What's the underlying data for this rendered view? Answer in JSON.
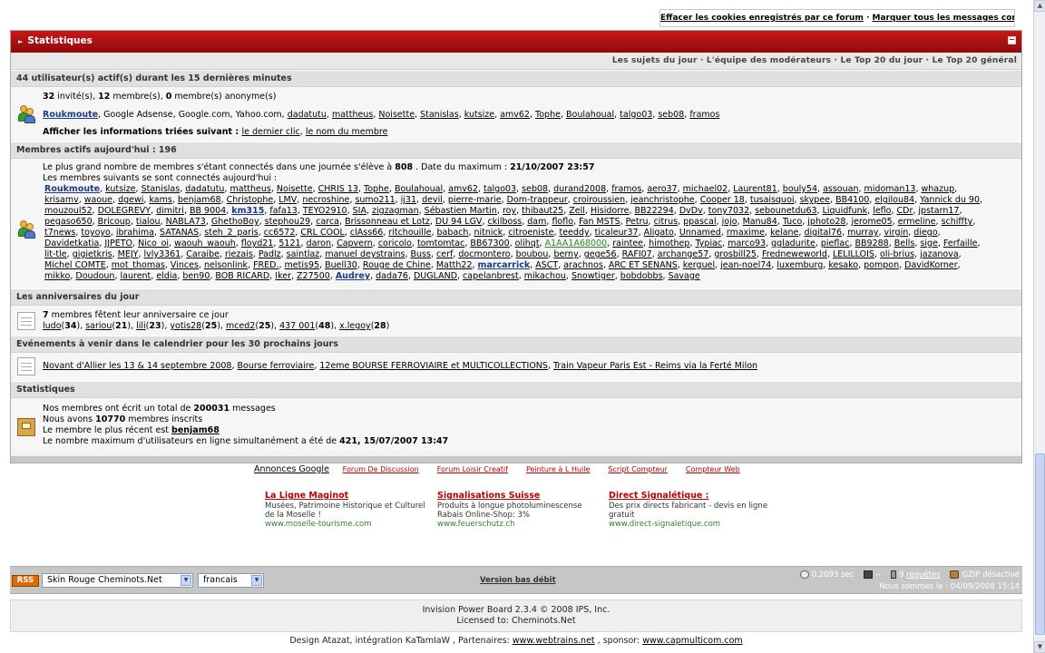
{
  "toplinks": {
    "clear_cookies": "Effacer les cookies enregistrés par ce forum",
    "separator": " · ",
    "mark_read": "Marquer tous les messages comme lus"
  },
  "panel": {
    "title": "Statistiques",
    "collapse_label": "−",
    "subnav": "Les sujets du jour · L'équipe des modérateurs · Le Top 20 du jour · Le Top 20 général"
  },
  "active_users": {
    "heading": "44 utilisateur(s) actif(s) durant les 15 dernières minutes",
    "guests_count": "32",
    "guests_label": " invité(s), ",
    "members_count": "12",
    "members_label": " membre(s), ",
    "anon_count": "0",
    "anon_label": " membre(s) anonyme(s)",
    "members": [
      "Roukmoute",
      "Google Adsense",
      "Google.com",
      "Yahoo.com",
      "dadatutu",
      "mattheus",
      "Noisette",
      "Stanislas",
      "kutsize",
      "amv62",
      "Tophe",
      "Boulahoual",
      "talgo03",
      "seb08",
      "framos"
    ],
    "sort_label": "Afficher les informations triées suivant : ",
    "sort_last_click": "le dernier clic",
    "sort_sep": ", ",
    "sort_name": "le nom du membre"
  },
  "active_today": {
    "heading": "Membres actifs aujourd'hui : 196",
    "record_prefix": "Le plus grand nombre de membres s'étant connectés dans une journée s'élève à ",
    "record_value": "808",
    "record_mid": " . Date du maximum : ",
    "record_date": "21/10/2007 23:57",
    "list_intro": "Les membres suivants se sont connectés aujourd'hui :",
    "members": [
      "Roukmoute",
      "kutsize",
      "Stanislas",
      "dadatutu",
      "mattheus",
      "Noisette",
      "CHRIS 13",
      "Tophe",
      "Boulahoual",
      "amv62",
      "talgo03",
      "seb08",
      "durand2008",
      "framos",
      "aero37",
      "michael02",
      "Laurent81",
      "bouly54",
      "assouan",
      "midoman13",
      "whazup",
      "krisamv",
      "waoue",
      "dgewi",
      "kams",
      "benjam68",
      "Christophe",
      "LMV",
      "necroshine",
      "sumo211",
      "ij31",
      "devil",
      "pierre-marie",
      "Dom-trappeur",
      "croiroussien",
      "jeanchristophe",
      "Cooper 18",
      "tusaisquoi",
      "skypee",
      "BB4100",
      "elgilou84",
      "Yannick du 90",
      "mouzoul52",
      "DOLEGREVY",
      "dimitri",
      "BB 9004",
      "km315",
      "fafa13",
      "TEYO2910",
      "SIA",
      "zigzagman",
      "Sébastien Martin",
      "roy",
      "thibaut25",
      "Zell",
      "Hisidorre",
      "BB22294",
      "DvDv",
      "tony7032",
      "sebounetdu63",
      "Liquidfunk",
      "leflo",
      "CDr",
      "jpstarn17",
      "pegaso650",
      "Bricoup",
      "tialou",
      "NABLA73",
      "GhethoBoy",
      "stephou29",
      "carca",
      "Brissonneau et Lotz",
      "DU 94 LGV",
      "ckilboss",
      "dam",
      "floflo",
      "Fan MSTS",
      "Petru",
      "citrus",
      "ppascal",
      "jojo",
      "Manu84",
      "Tuco",
      "jphoto28",
      "jerome05",
      "ermeline",
      "schiffty",
      "t7news",
      "toyoyo",
      "ibrahima",
      "SATANAS",
      "steh_2_paris",
      "cc6572",
      "CRL COOL",
      "clAss66",
      "ritchouille",
      "babach",
      "nitnick",
      "citroeniste",
      "teeddy",
      "ticaleur37",
      "Aligato",
      "Unnamed",
      "rmaxime",
      "kelane",
      "digital76",
      "murray",
      "virgin",
      "diego",
      "Davidetkatia",
      "JJPETO",
      "Nico_oi",
      "waouh_waouh",
      "floyd21",
      "5121",
      "daron",
      "Capvern",
      "coricolo",
      "tomtomtac",
      "BB67300",
      "olihqt",
      "A1AA1A68000",
      "raintee",
      "himothep",
      "Typiac",
      "marco93",
      "ggladurite",
      "pieflac",
      "BB9288",
      "Bells",
      "sige",
      "Ferfaille",
      "lit-tle",
      "gigietkris",
      "MEJY",
      "lvly3361",
      "Caraibe",
      "riezais",
      "Padlz",
      "saintlaz",
      "manuel deystrains",
      "Buss",
      "cerf",
      "docmontero",
      "boubou",
      "berny",
      "gege56",
      "RAFI07",
      "archange57",
      "grosbill25",
      "Fredneweworld",
      "LELILLOIS",
      "oli-brius",
      "jazanova",
      "Michel COMTE",
      "mot_thomas",
      "Vinces",
      "nelsonlink",
      "FRED.",
      "metis95",
      "Buell30",
      "Rouge de Chine",
      "Matth22",
      "marcarrick",
      "ASCT",
      "arachnos",
      "ARC ET SENANS",
      "kerguel",
      "jean-noel74",
      "luxemburg",
      "kesako",
      "pompon",
      "DavidKorner",
      "mikko",
      "Doudoun",
      "laurent",
      "eldia",
      "ben90",
      "BOB RICARD",
      "Iker",
      "Z27500",
      "Audrey",
      "dada76",
      "DUGLAND",
      "capelanbrest",
      "mikachou",
      "Snowtiger",
      "bobdobbs",
      "Savage"
    ]
  },
  "birthdays": {
    "heading": "Les anniversaires du jour",
    "count": "7",
    "label": " membres fêtent leur anniversaire ce jour",
    "people": [
      {
        "name": "ludo",
        "age": "34"
      },
      {
        "name": "sariou",
        "age": "21"
      },
      {
        "name": "lili",
        "age": "23"
      },
      {
        "name": "yotis28",
        "age": "25"
      },
      {
        "name": "mced2",
        "age": "25"
      },
      {
        "name": "437 001",
        "age": "48"
      },
      {
        "name": "x.legoy",
        "age": "28"
      }
    ]
  },
  "events": {
    "heading": "Evénements à venir dans le calendrier pour les 30 prochains jours",
    "items": [
      "Novant d'Allier les 13 & 14 septembre 2008",
      "Bourse ferroviaire",
      "12eme BOURSE FERROVIAIRE et MULTICOLLECTIONS",
      "Train Vapeur Paris Est - Reims via la Ferté Milon"
    ]
  },
  "statistics": {
    "heading": "Statistiques",
    "posts_prefix": "Nos membres ont écrit un total de ",
    "posts_value": "200031",
    "posts_suffix": " messages",
    "members_prefix": "Nous avons ",
    "members_value": "10770",
    "members_suffix": " membres inscrits",
    "newest_prefix": "Le membre le plus récent est ",
    "newest_name": "benjam68",
    "max_prefix": "Le nombre maximum d'utilisateurs en ligne simultanément a été de ",
    "max_value": "421, 15/07/2007 13:47"
  },
  "ads": {
    "google_label": "Annonces Google",
    "categories": [
      "Forum De Discussion",
      "Forum Loisir Creatif",
      "Peinture à L Huile",
      "Script Compteur",
      "Compteur Web"
    ],
    "items": [
      {
        "title": "La Ligne Maginot",
        "desc": "Musées, Patrimoine Historique et Culturel de la Moselle !",
        "url": "www.moselle-tourisme.com"
      },
      {
        "title": "Signalisations Suisse",
        "desc": "Produits à longue photoluminescense Rabais Online-Shop: 3%",
        "url": "www.feuerschutz.ch"
      },
      {
        "title": "Direct Signalétique :",
        "desc": "Des prix directs fabricant - devis en ligne gratuit",
        "url": "www.direct-signaletique.com"
      }
    ]
  },
  "footer": {
    "rss_label": "RSS",
    "skin_selected": "Skin Rouge Cheminots.Net",
    "language_selected": "francais",
    "low_bandwidth": "Version bas débit",
    "exec_time": "0.2093 sec",
    "server_load": "--",
    "queries_count": "9 ",
    "queries_label": "requêtes",
    "gzip": "GZIP désactivé",
    "date": "Nous sommes le : 04/09/2008 15:14"
  },
  "copyright": {
    "line1": "Invision Power Board 2.3.4 © 2008  IPS, Inc.",
    "line2": "Licensed to: Cheminots.Net"
  },
  "credits": {
    "prefix": "Design Atazat, intégration KaTamIaW , Partenaires: ",
    "partner1": "www.webtrains.net",
    "mid": " , sponsor: ",
    "sponsor": "www.capmulticom.com"
  }
}
